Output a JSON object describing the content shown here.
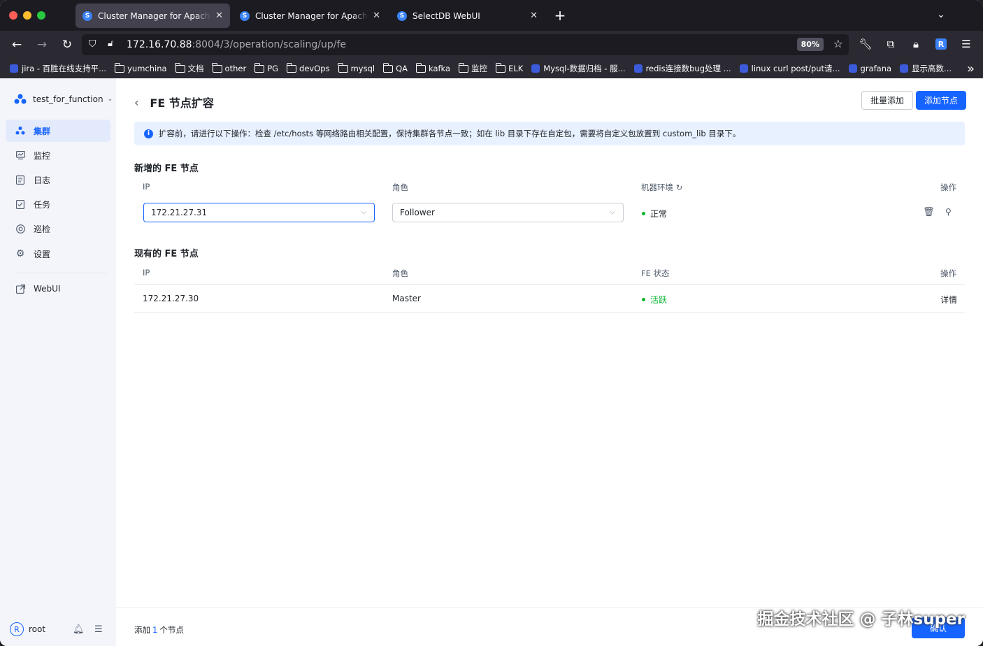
{
  "browser": {
    "tabs": [
      {
        "title": "Cluster Manager for Apache Doris"
      },
      {
        "title": "Cluster Manager for Apache Doris"
      },
      {
        "title": "SelectDB WebUI"
      }
    ],
    "url_host": "172.16.70.88",
    "url_rest": ":8004/3/operation/scaling/up/fe",
    "zoom": "80%",
    "bookmarks": [
      {
        "label": "jira - 百胜在线支持平...",
        "type": "site"
      },
      {
        "label": "yumchina",
        "type": "folder"
      },
      {
        "label": "文档",
        "type": "folder"
      },
      {
        "label": "other",
        "type": "folder"
      },
      {
        "label": "PG",
        "type": "folder"
      },
      {
        "label": "devOps",
        "type": "folder"
      },
      {
        "label": "mysql",
        "type": "folder"
      },
      {
        "label": "QA",
        "type": "folder"
      },
      {
        "label": "kafka",
        "type": "folder"
      },
      {
        "label": "监控",
        "type": "folder"
      },
      {
        "label": "ELK",
        "type": "folder"
      },
      {
        "label": "Mysql-数据归档 - 服...",
        "type": "site"
      },
      {
        "label": "redis连接数bug处理 ...",
        "type": "site"
      },
      {
        "label": "linux curl post/put请...",
        "type": "site"
      },
      {
        "label": "grafana",
        "type": "site"
      },
      {
        "label": "显示高数...",
        "type": "site"
      }
    ]
  },
  "sidebar": {
    "cluster_name": "test_for_function",
    "items": [
      {
        "label": "集群",
        "icon": "cluster-icon",
        "active": true
      },
      {
        "label": "监控",
        "icon": "monitor-icon"
      },
      {
        "label": "日志",
        "icon": "log-icon"
      },
      {
        "label": "任务",
        "icon": "task-icon"
      },
      {
        "label": "巡检",
        "icon": "inspect-icon"
      },
      {
        "label": "设置",
        "icon": "gear-icon"
      }
    ],
    "webui_label": "WebUI",
    "user": {
      "initial": "R",
      "name": "root"
    }
  },
  "main": {
    "title": "FE 节点扩容",
    "batch_add_label": "批量添加",
    "add_node_label": "添加节点",
    "alert_text": "扩容前，请进行以下操作：检查 /etc/hosts 等网络路由相关配置，保持集群各节点一致；如在 lib 目录下存在自定包，需要将自定义包放置到 custom_lib 目录下。",
    "new_section": {
      "title": "新增的 FE 节点",
      "headers": {
        "ip": "IP",
        "role": "角色",
        "env": "机器环境",
        "ops": "操作"
      },
      "row": {
        "ip": "172.21.27.31",
        "role": "Follower",
        "env_status": "正常"
      }
    },
    "existing_section": {
      "title": "现有的 FE 节点",
      "headers": {
        "ip": "IP",
        "role": "角色",
        "status": "FE 状态",
        "ops": "操作"
      },
      "rows": [
        {
          "ip": "172.21.27.30",
          "role": "Master",
          "status": "活跃",
          "action": "详情"
        }
      ]
    },
    "footer": {
      "prefix": "添加",
      "count": "1",
      "suffix": "个节点",
      "confirm_label": "确认"
    },
    "watermark": "掘金技术社区 @ 子林super"
  },
  "colors": {
    "primary": "#1664ff",
    "success": "#00b42a",
    "sidebar_bg": "#f3f5fb"
  }
}
